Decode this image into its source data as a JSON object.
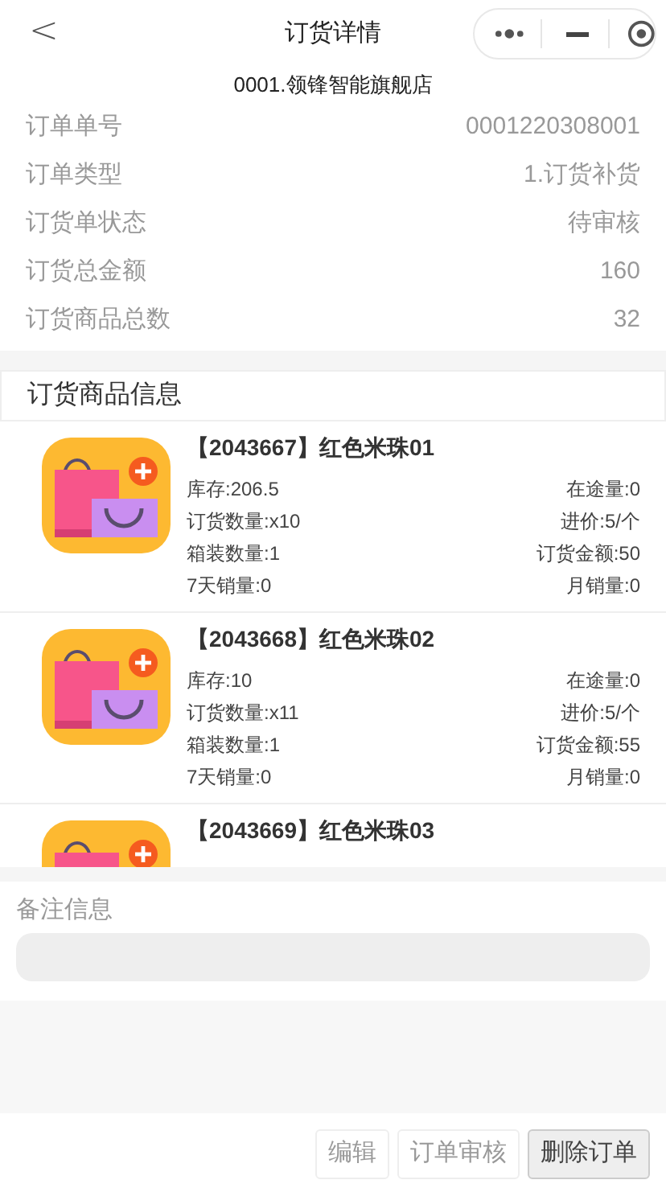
{
  "header": {
    "title": "订货详情",
    "back": "<"
  },
  "store": "0001.领锋智能旗舰店",
  "info": [
    {
      "label": "订单单号",
      "value": "0001220308001"
    },
    {
      "label": "订单类型",
      "value": "1.订货补货"
    },
    {
      "label": "订货单状态",
      "value": "待审核"
    },
    {
      "label": "订货总金额",
      "value": "160"
    },
    {
      "label": "订货商品总数",
      "value": "32"
    }
  ],
  "products_section": {
    "title": "订货商品信息",
    "items": [
      {
        "name": "【2043667】红色米珠01",
        "stats": [
          [
            "库存:206.5",
            "在途量:0"
          ],
          [
            "订货数量:x10",
            "进价:5/个"
          ],
          [
            "箱装数量:1",
            "订货金额:50"
          ],
          [
            "7天销量:0",
            "月销量:0"
          ]
        ]
      },
      {
        "name": "【2043668】红色米珠02",
        "stats": [
          [
            "库存:10",
            "在途量:0"
          ],
          [
            "订货数量:x11",
            "进价:5/个"
          ],
          [
            "箱装数量:1",
            "订货金额:55"
          ],
          [
            "7天销量:0",
            "月销量:0"
          ]
        ]
      },
      {
        "name": "【2043669】红色米珠03"
      }
    ]
  },
  "notes": {
    "label": "备注信息"
  },
  "buttons": [
    {
      "label": "编辑",
      "active": false
    },
    {
      "label": "订单审核",
      "active": false
    },
    {
      "label": "删除订单",
      "active": true
    }
  ]
}
